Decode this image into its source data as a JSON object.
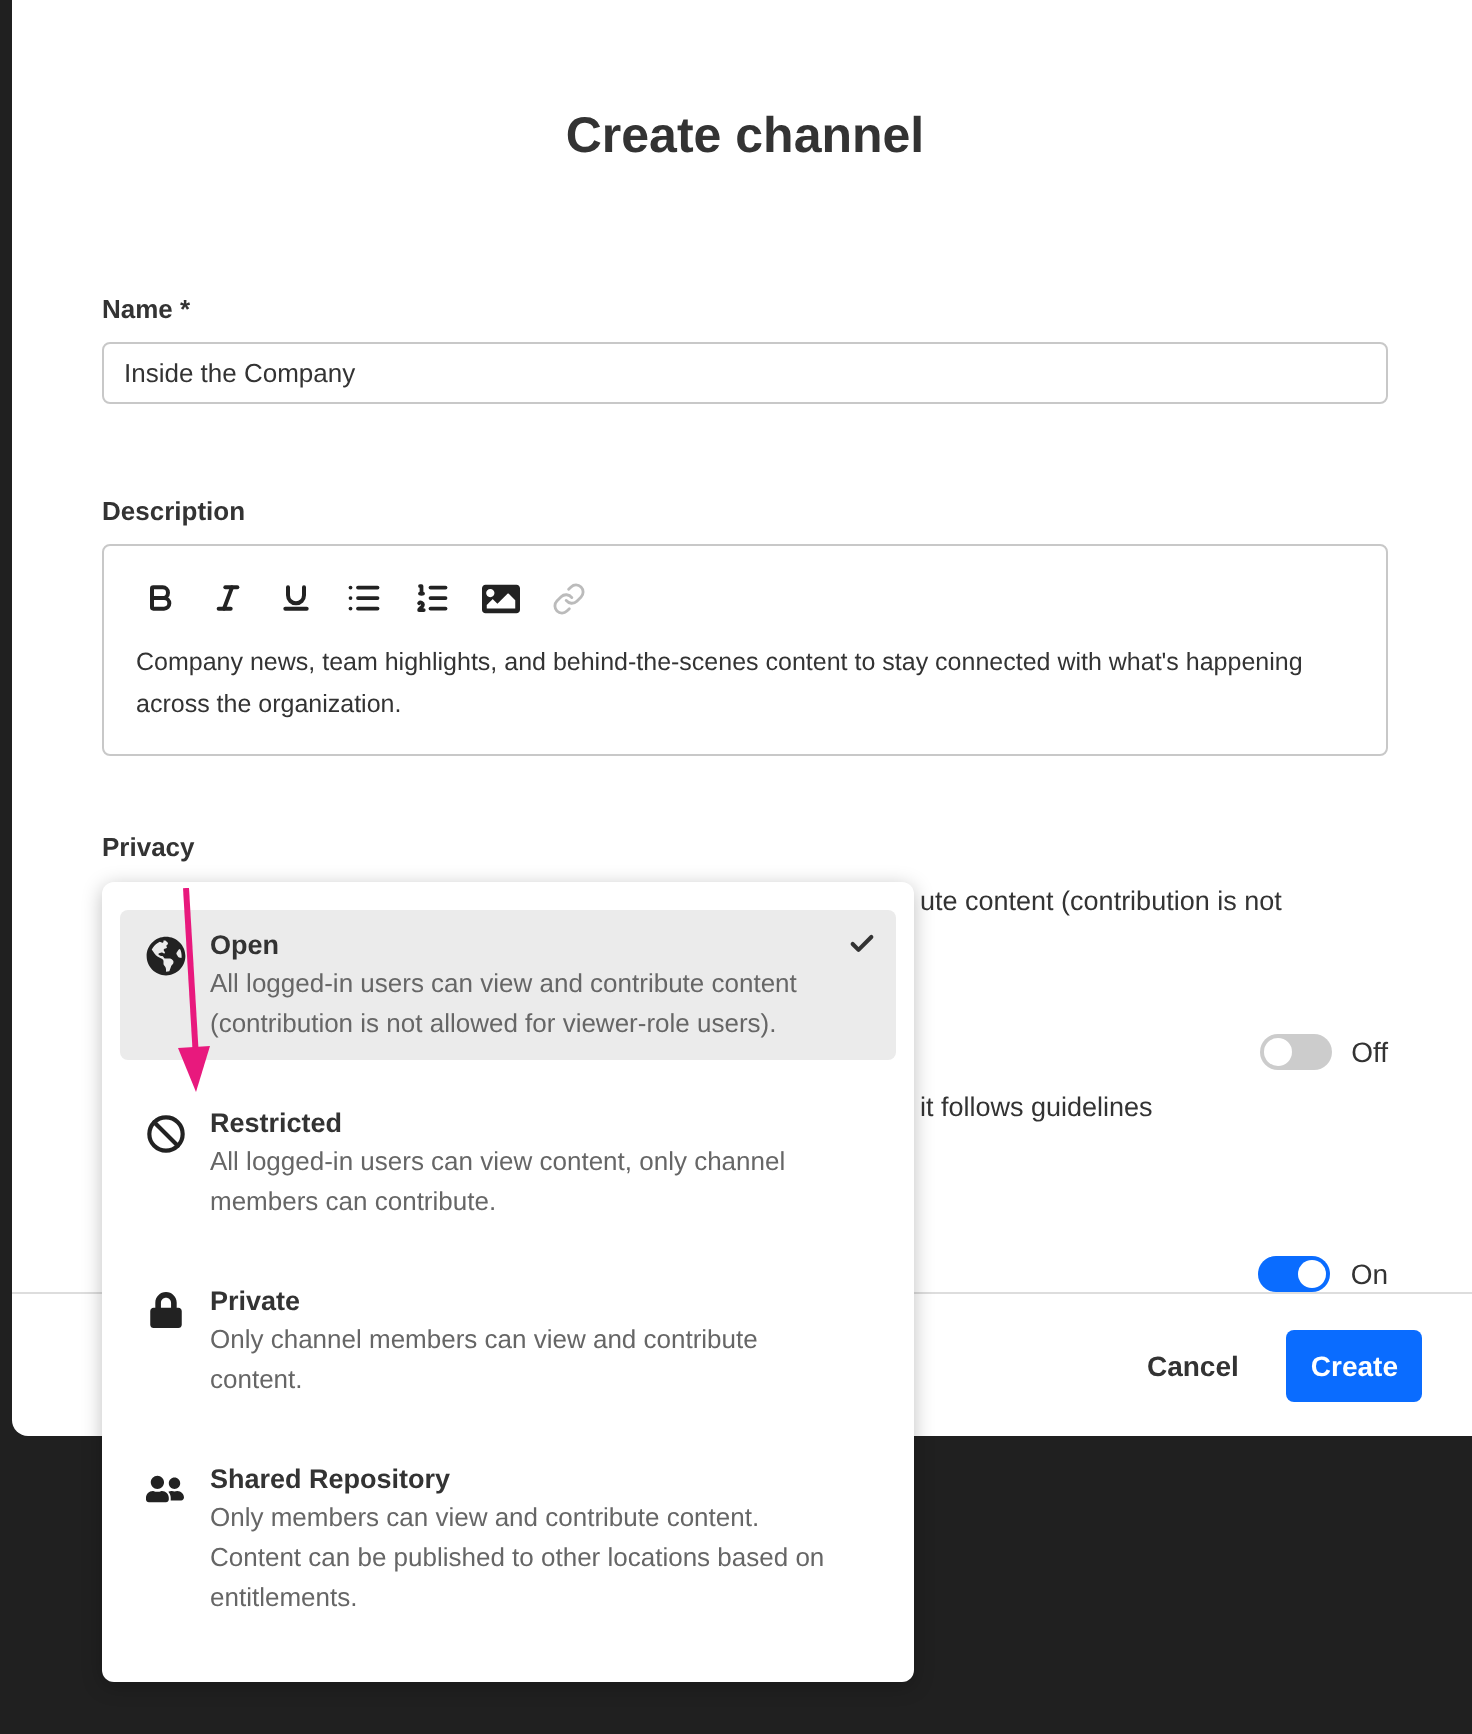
{
  "dialog": {
    "title": "Create channel",
    "name_field": {
      "label": "Name *",
      "value": "Inside the Company"
    },
    "description_field": {
      "label": "Description",
      "value": "Company news, team highlights, and behind-the-scenes content to stay connected with what's happening across the organization.",
      "toolbar": [
        {
          "kind": "bold",
          "disabled": false
        },
        {
          "kind": "italic",
          "disabled": false
        },
        {
          "kind": "underline",
          "disabled": false
        },
        {
          "kind": "bullets",
          "disabled": false
        },
        {
          "kind": "numbers",
          "disabled": false
        },
        {
          "kind": "image",
          "disabled": false
        },
        {
          "kind": "link",
          "disabled": true
        }
      ]
    },
    "privacy_label": "Privacy",
    "privacy_hint": "ute content (contribution is not",
    "toggles": [
      {
        "on": false,
        "label": "Off",
        "hint": "it follows guidelines"
      },
      {
        "on": true,
        "label": "On"
      }
    ],
    "buttons": [
      "Cancel",
      "Create"
    ]
  },
  "privacy_menu": [
    {
      "kind": "globe",
      "title": "Open",
      "description": "All logged-in users can view and contribute content (contribution is not allowed for viewer-role users).",
      "selected": true
    },
    {
      "kind": "ban",
      "title": "Restricted",
      "description": "All logged-in users can view content, only channel members can contribute.",
      "selected": false
    },
    {
      "kind": "lock",
      "title": "Private",
      "description": "Only channel members can view and contribute content.",
      "selected": false
    },
    {
      "kind": "people",
      "title": "Shared Repository",
      "description": "Only members can view and contribute content. Content can be published to other locations based on entitlements.",
      "selected": false
    }
  ]
}
